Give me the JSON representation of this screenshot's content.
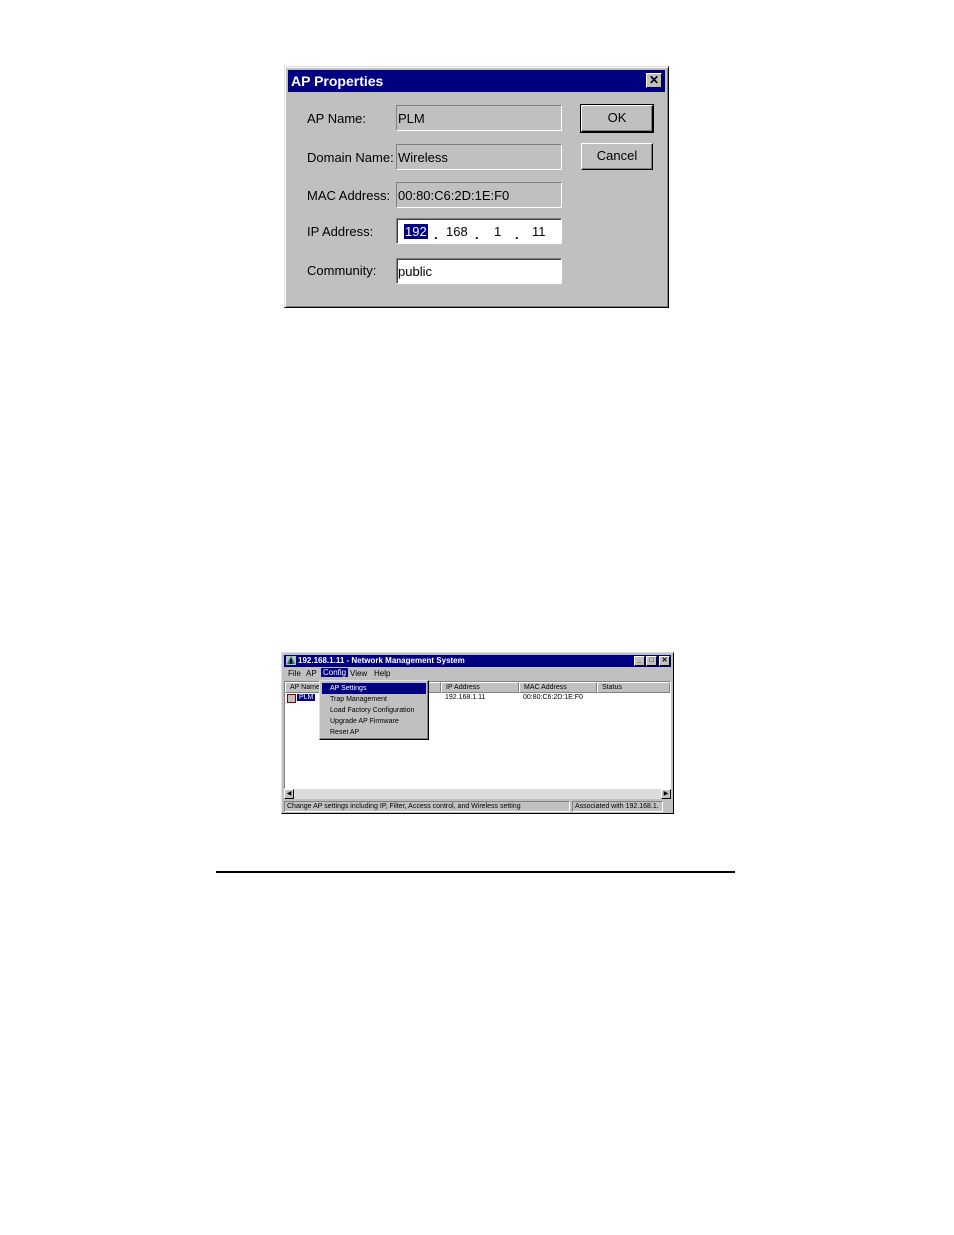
{
  "dialog": {
    "title": "AP Properties",
    "close_glyph": "✕",
    "fields": {
      "ap_name": {
        "label": "AP Name:",
        "value": "PLM"
      },
      "domain_name": {
        "label": "Domain Name:",
        "value": "Wireless"
      },
      "mac_address": {
        "label": "MAC Address:",
        "value": "00:80:C6:2D:1E:F0"
      },
      "ip_address": {
        "label": "IP Address:",
        "octets": [
          "192",
          "168",
          "1",
          "11"
        ]
      },
      "community": {
        "label": "Community:",
        "value": "public"
      }
    },
    "ok_label": "OK",
    "cancel_label": "Cancel"
  },
  "nms_window": {
    "title": "192.168.1.11 - Network Management System",
    "controls": [
      "_",
      "□",
      "✕"
    ],
    "menu": [
      "File",
      "AP",
      "Config",
      "View",
      "Help"
    ],
    "active_menu": "Config",
    "columns": [
      "AP Name",
      "IP Address",
      "MAC Address",
      "Status"
    ],
    "rows": [
      {
        "name": "PLM",
        "ip": "192.168.1.11",
        "mac": "00:80:C6:2D:1E:F0",
        "status": ""
      }
    ],
    "config_menu_items": [
      "AP Settings",
      "Trap Management",
      "Load Factory Configuration",
      "Upgrade AP Firmware",
      "Reset AP"
    ],
    "highlighted_item": "AP Settings",
    "status_left": "Change AP settings including IP, Filter, Access control, and Wireless setting",
    "status_right": "Associated with 192.168.1."
  },
  "icons": {
    "close": "close-icon",
    "minimize": "minimize-icon",
    "maximize": "maximize-icon",
    "app": "network-app-icon",
    "ap": "access-point-icon",
    "scroll_left": "arrow-left-icon",
    "scroll_right": "arrow-right-icon"
  },
  "colors": {
    "titlebar": "#000080",
    "window_face": "#c0c0c0",
    "selection": "#000080"
  }
}
